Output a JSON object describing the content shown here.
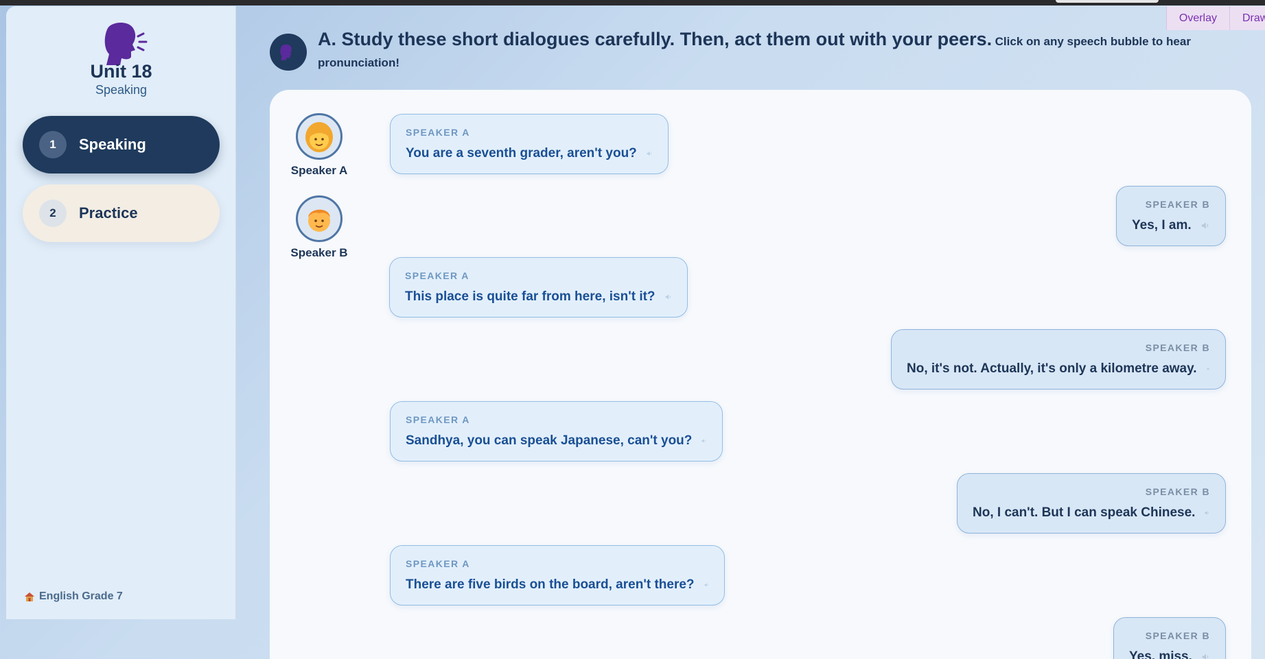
{
  "top_actions": {
    "overlay": "Overlay",
    "draw": "Draw"
  },
  "sidebar": {
    "unit_title": "Unit 18",
    "unit_subtitle": "Speaking",
    "nav": [
      {
        "num": "1",
        "label": "Speaking",
        "active": true
      },
      {
        "num": "2",
        "label": "Practice",
        "active": false
      }
    ],
    "footer": "English Grade 7",
    "footer_icon": "home-icon"
  },
  "header": {
    "title": "A. Study these short dialogues carefully. Then, act them out with your peers.",
    "hint": "Click on any speech bubble to hear pronunciation!"
  },
  "legend": {
    "speaker_a": "Speaker A",
    "speaker_b": "Speaker B"
  },
  "dialogue": [
    {
      "speaker": "SPEAKER A",
      "text": "You are a seventh grader, aren't you?"
    },
    {
      "speaker": "SPEAKER B",
      "text": "Yes, I am."
    },
    {
      "speaker": "SPEAKER A",
      "text": "This place is quite far from here, isn't it?"
    },
    {
      "speaker": "SPEAKER B",
      "text": "No, it's not. Actually, it's only a kilometre away."
    },
    {
      "speaker": "SPEAKER A",
      "text": "Sandhya, you can speak Japanese, can't you?"
    },
    {
      "speaker": "SPEAKER B",
      "text": "No, I can't. But I can speak Chinese."
    },
    {
      "speaker": "SPEAKER A",
      "text": "There are five birds on the board, aren't there?"
    },
    {
      "speaker": "SPEAKER B",
      "text": "Yes, miss."
    }
  ],
  "colors": {
    "navy": "#1f3a5c",
    "bubble_a_bg": "#e2effb",
    "bubble_b_bg": "#d8e7f6",
    "accent_purple": "#5b2a9c"
  }
}
